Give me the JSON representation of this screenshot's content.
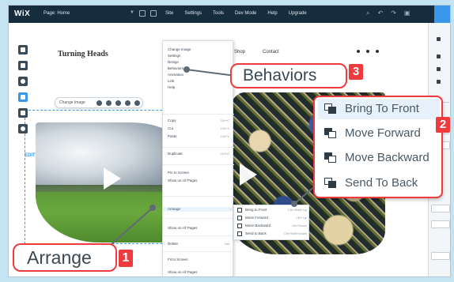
{
  "topbar": {
    "logo": "WiX",
    "page_label": "Page: Home",
    "menu": [
      "Site",
      "Settings",
      "Tools",
      "Dev Mode",
      "Help",
      "Upgrade"
    ]
  },
  "site": {
    "title": "Turning Heads",
    "nav": [
      "Shop",
      "Contact"
    ],
    "image_toolbar_label": "Change Image",
    "edit_marker": "EDIT"
  },
  "context_menu": {
    "items": [
      {
        "label": "Change Image",
        "shortcut": ""
      },
      {
        "label": "Settings",
        "shortcut": ""
      },
      {
        "label": "Design",
        "shortcut": ""
      },
      {
        "label": "Behaviors",
        "shortcut": ""
      },
      {
        "label": "Animation",
        "shortcut": ""
      },
      {
        "label": "Link",
        "shortcut": ""
      },
      {
        "label": "Help",
        "shortcut": ""
      },
      {
        "label": "Copy",
        "shortcut": "Ctrl+C"
      },
      {
        "label": "Cut",
        "shortcut": "Ctrl+X"
      },
      {
        "label": "Paste",
        "shortcut": "Ctrl+V"
      },
      {
        "label": "Duplicate",
        "shortcut": "Ctrl+D"
      },
      {
        "label": "Pin to Screen",
        "shortcut": ""
      },
      {
        "label": "Show on All Pages",
        "shortcut": ""
      },
      {
        "label": "Arrange",
        "shortcut": ""
      },
      {
        "label": "Show on All Pages",
        "shortcut": ""
      },
      {
        "label": "Delete",
        "shortcut": "Del"
      },
      {
        "label": "Fit to Screen",
        "shortcut": ""
      },
      {
        "label": "Show on All Pages",
        "shortcut": ""
      }
    ]
  },
  "sub_menu": {
    "items": [
      {
        "label": "Bring to Front",
        "shortcut": "Ctrl+Shift+Up"
      },
      {
        "label": "Move Forward",
        "shortcut": "Ctrl+Up"
      },
      {
        "label": "Move Backward",
        "shortcut": "Ctrl+Down"
      },
      {
        "label": "Send to Back",
        "shortcut": "Ctrl+Shift+Down"
      }
    ]
  },
  "callouts": {
    "behaviors": {
      "label": "Behaviors",
      "number": "3"
    },
    "arrange": {
      "label": "Arrange",
      "number": "1"
    },
    "arrange_options": {
      "number": "2",
      "items": [
        {
          "label": "Bring To Front",
          "icon": "bring-to-front-icon"
        },
        {
          "label": "Move Forward",
          "icon": "move-forward-icon"
        },
        {
          "label": "Move Backward",
          "icon": "move-backward-icon"
        },
        {
          "label": "Send To Back",
          "icon": "send-to-back-icon"
        }
      ]
    }
  },
  "colors": {
    "callout_red": "#ef3a3e",
    "topbar": "#162d3d",
    "accent": "#3899ec",
    "backdrop": "#c4e4f3"
  }
}
